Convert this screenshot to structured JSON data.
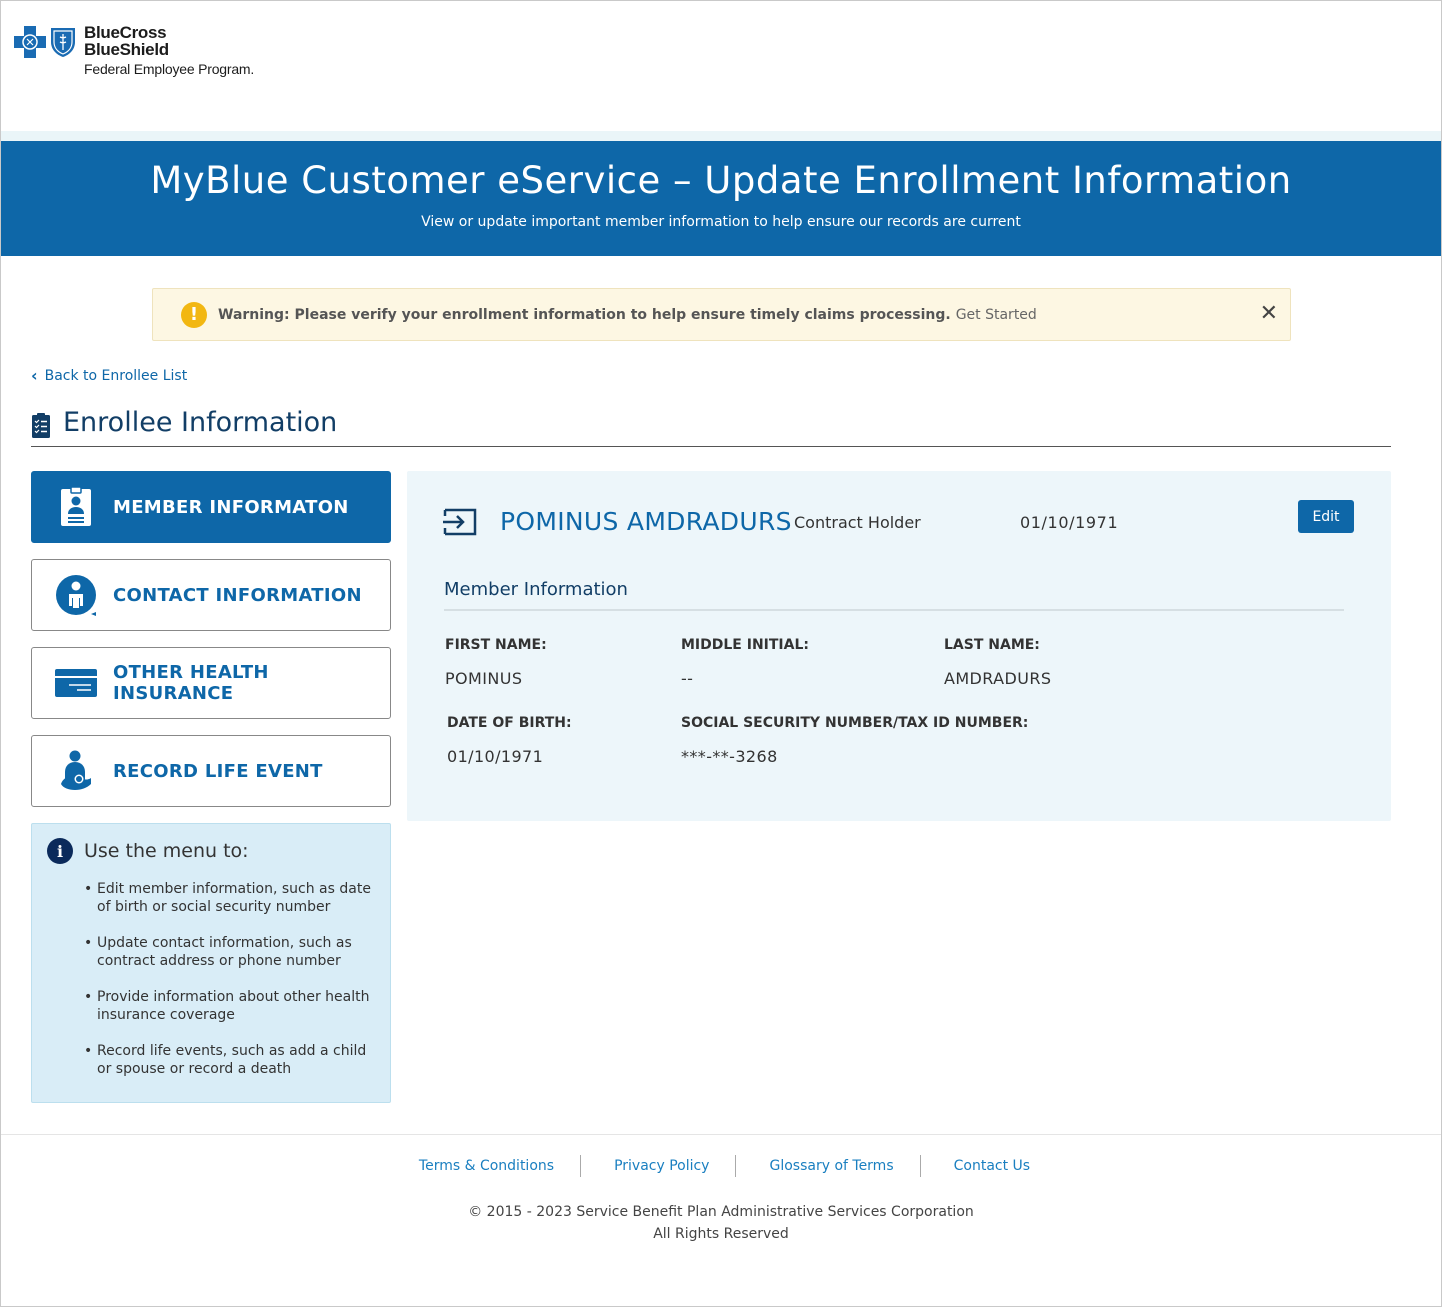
{
  "logo": {
    "line1": "BlueCross",
    "line2": "BlueShield",
    "line3": "Federal Employee Program."
  },
  "banner": {
    "title": "MyBlue Customer eService – Update Enrollment Information",
    "subtitle": "View or update important member information to help ensure our records are current"
  },
  "warning": {
    "text": "Warning: Please verify your enrollment information to help ensure timely claims processing.",
    "link": "Get Started",
    "close": "✕"
  },
  "back_link": "Back to Enrollee List",
  "section_title": "Enrollee Information",
  "menu": [
    {
      "label": "MEMBER INFORMATON"
    },
    {
      "label": "CONTACT INFORMATION"
    },
    {
      "label": "OTHER HEALTH INSURANCE"
    },
    {
      "label": "RECORD LIFE EVENT"
    }
  ],
  "info_box": {
    "heading": "Use the menu to:",
    "items": [
      "Edit member information, such as date of birth or social security number",
      "Update contact information, such as contract address or phone number",
      "Provide information about other health insurance coverage",
      "Record life events, such as add a child or spouse or record a death"
    ]
  },
  "member": {
    "name": "POMINUS AMDRADURS",
    "role": "Contract Holder",
    "dob": "01/10/1971",
    "edit_label": "Edit",
    "section_heading": "Member Information",
    "fields": {
      "first_name_label": "FIRST NAME:",
      "first_name": "POMINUS",
      "middle_initial_label": "MIDDLE INITIAL:",
      "middle_initial": "--",
      "last_name_label": "LAST NAME:",
      "last_name": "AMDRADURS",
      "dob_label": "DATE OF BIRTH:",
      "dob": "01/10/1971",
      "ssn_label": "SOCIAL SECURITY NUMBER/TAX ID NUMBER:",
      "ssn": "***-**-3268"
    }
  },
  "footer": {
    "links": [
      "Terms & Conditions",
      "Privacy Policy",
      "Glossary of Terms",
      "Contact Us"
    ],
    "copyright": "© 2015 - 2023 Service Benefit Plan Administrative Services Corporation",
    "rights": "All Rights Reserved"
  },
  "colors": {
    "brand_blue": "#0e67a8",
    "warning_bg": "#fdf7e3",
    "info_bg": "#d9edf7",
    "panel_bg": "#edf6fa"
  }
}
